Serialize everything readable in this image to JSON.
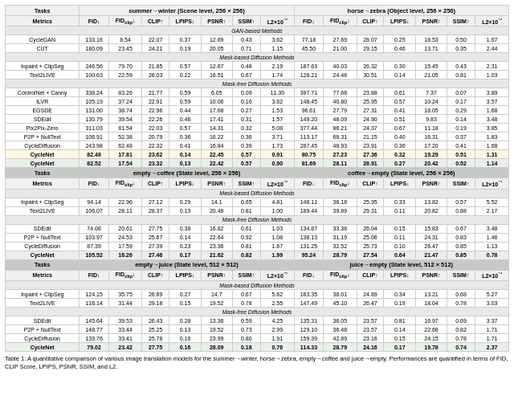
{
  "caption": "Table 1: A quantitative comparison of various image translation models for the summer→winter, horse→zebra, empty→coffee and juice→empty. Performances are quantified in terms of FID, CLIP Score, LPIPS, PSNR, SSIM, and L2.",
  "sections": [
    {
      "tasks_label": "Tasks",
      "task1": "summer→winter (Scene level, 256 × 256)",
      "task2": "horse→zebra (Object level, 256 × 256)",
      "metrics_label": "Metrics",
      "cols": [
        "FID↓",
        "FID_clip↓",
        "CLIP↑",
        "LPIPS↓",
        "PSNR↑",
        "SSIM↑",
        "L2×10⁻¹",
        "FID↓",
        "FID_clip↓",
        "CLIP↑",
        "LPIPS↓",
        "PSNR↑",
        "SSIM↑",
        "L2×10⁻¹"
      ],
      "gan_methods_label": "GAN-based Methods",
      "gan_rows": [
        {
          "name": "CycleGAN",
          "vals": [
            "133.16",
            "8.54",
            "22.07",
            "0.37",
            "12.69",
            "0.43",
            "3.62",
            "77.18",
            "27.69",
            "28.07",
            "0.25",
            "18.53",
            "0.50",
            "1.67"
          ]
        },
        {
          "name": "CUT",
          "vals": [
            "180.09",
            "23.45",
            "24.21",
            "0.19",
            "20.05",
            "0.71",
            "1.15",
            "45.50",
            "21.00",
            "29.15",
            "0.46",
            "13.71",
            "0.35",
            "2.44"
          ]
        }
      ],
      "mask_methods_label": "Mask-based Diffusion Methods",
      "mask_rows": [
        {
          "name": "Inpaint + ClipSeg",
          "vals": [
            "246.56",
            "79.70",
            "21.85",
            "0.57",
            "12.67",
            "0.48",
            "2.19",
            "187.63",
            "40.03",
            "26.32",
            "0.30",
            "15.45",
            "0.43",
            "2.31"
          ]
        },
        {
          "name": "Text2LIVE",
          "vals": [
            "100.63",
            "22.59",
            "26.03",
            "0.22",
            "16.51",
            "0.67",
            "1.74",
            "128.21",
            "24.46",
            "30.51",
            "0.14",
            "21.05",
            "0.81",
            "1.03"
          ]
        }
      ],
      "free_methods_label": "Mask-free Diffusion Methods",
      "free_rows": [
        {
          "name": "ControlNet + Canny",
          "vals": [
            "338.24",
            "83.26",
            "21.77",
            "0.59",
            "6.05",
            "0.09",
            "11.30",
            "397.71",
            "77.68",
            "23.88",
            "0.61",
            "7.37",
            "0.07",
            "3.89"
          ]
        },
        {
          "name": "ILVR",
          "vals": [
            "105.19",
            "37.24",
            "22.91",
            "0.59",
            "10.06",
            "0.16",
            "3.62",
            "148.45",
            "40.80",
            "25.95",
            "0.57",
            "10.24",
            "0.17",
            "3.57"
          ]
        },
        {
          "name": "EGSDE",
          "vals": [
            "131.00",
            "38.74",
            "22.96",
            "0.44",
            "17.68",
            "0.27",
            "1.53",
            "96.61",
            "27.79",
            "27.31",
            "0.41",
            "18.05",
            "0.29",
            "1.68"
          ]
        },
        {
          "name": "SDEdit",
          "vals": [
            "130.79",
            "39.54",
            "22.26",
            "0.46",
            "17.41",
            "0.31",
            "1.57",
            "149.20",
            "48.09",
            "24.90",
            "0.51",
            "9.83",
            "0.14",
            "3.48"
          ]
        },
        {
          "name": "Pix2Pix-Zero",
          "vals": [
            "311.03",
            "81.54",
            "22.03",
            "0.57",
            "14.31",
            "0.32",
            "5.08",
            "377.44",
            "86.21",
            "24.37",
            "0.67",
            "11.18",
            "0.19",
            "3.85"
          ]
        },
        {
          "name": "P2P + NullText",
          "vals": [
            "106.91",
            "52.38",
            "20.79",
            "0.36",
            "16.22",
            "0.36",
            "3.71",
            "113.17",
            "68.31",
            "21.15",
            "0.40",
            "16.31",
            "0.37",
            "1.83"
          ]
        },
        {
          "name": "CycleDiffusion",
          "vals": [
            "243.98",
            "62.48",
            "22.32",
            "0.41",
            "16.84",
            "0.39",
            "1.73",
            "287.45",
            "48.93",
            "23.91",
            "0.36",
            "17.20",
            "0.41",
            "1.68"
          ]
        },
        {
          "name": "CycleNet",
          "vals": [
            "82.48",
            "17.81",
            "23.62",
            "0.14",
            "22.45",
            "0.57",
            "0.91",
            "80.75",
            "27.23",
            "27.36",
            "0.32",
            "19.29",
            "0.51",
            "1.31"
          ],
          "bold": true
        },
        {
          "name": "CycleNet",
          "vals": [
            "82.52",
            "17.54",
            "23.32",
            "0.13",
            "22.42",
            "0.57",
            "0.90",
            "81.69",
            "28.11",
            "28.91",
            "0.27",
            "20.42",
            "0.52",
            "1.14"
          ],
          "bold": true
        }
      ]
    },
    {
      "tasks_label": "Tasks",
      "task1": "empty→coffee (State level, 256 × 256)",
      "task2": "coffee→empty (State level, 256 × 256)",
      "cols": [
        "FID↓",
        "FID_clip↓",
        "CLIP↑",
        "LPIPS↓",
        "PSNR↑",
        "SSIM↑",
        "L2×10⁻¹",
        "FID↓",
        "FID_clip↓",
        "CLIP↑",
        "LPIPS↓",
        "PSNR↑",
        "SSIM↑",
        "L2×10⁻¹"
      ],
      "mask_rows": [
        {
          "name": "Inpaint + ClipSeg",
          "vals": [
            "94.14",
            "22.96",
            "27.12",
            "0.29",
            "14.1",
            "0.65",
            "4.81",
            "148.11",
            "36.18",
            "25.95",
            "0.33",
            "13.82",
            "0.57",
            "5.52"
          ]
        },
        {
          "name": "Text2LIVE",
          "vals": [
            "106.07",
            "28.11",
            "28.37",
            "0.13",
            "20.48",
            "0.81",
            "1.00",
            "189.44",
            "39.89",
            "29.31",
            "0.11",
            "20.82",
            "0.88",
            "2.17"
          ]
        }
      ],
      "free_rows": [
        {
          "name": "SDEdit",
          "vals": [
            "74.08",
            "20.61",
            "27.75",
            "0.38",
            "16.82",
            "0.61",
            "1.03",
            "134.87",
            "33.38",
            "26.04",
            "0.15",
            "15.83",
            "0.67",
            "3.48"
          ]
        },
        {
          "name": "P2P + NullText",
          "vals": [
            "103.97",
            "24.53",
            "25.67",
            "0.14",
            "22.64",
            "0.92",
            "1.08",
            "138.13",
            "31.19",
            "25.06",
            "0.11",
            "24.31",
            "0.83",
            "1.46"
          ]
        },
        {
          "name": "CycleDiffusion",
          "vals": [
            "87.39",
            "17.59",
            "27.39",
            "0.23",
            "23.36",
            "0.81",
            "1.67",
            "131.25",
            "32.52",
            "25.73",
            "0.10",
            "26.47",
            "0.85",
            "1.13"
          ]
        },
        {
          "name": "CycleNet",
          "vals": [
            "105.52",
            "16.26",
            "27.46",
            "0.17",
            "21.62",
            "0.82",
            "1.99",
            "95.24",
            "28.79",
            "27.54",
            "0.64",
            "21.47",
            "0.85",
            "0.78"
          ],
          "bold": true
        }
      ]
    },
    {
      "tasks_label": "Tasks",
      "task1": "empty→juice (State level, 512 × 512)",
      "task2": "juice→empty (State level, 512 × 512)",
      "cols": [
        "FID↓",
        "FID_clip↓",
        "CLIP↑",
        "LPIPS↓",
        "PSNR↑",
        "SSIM↑",
        "L2×10⁻¹",
        "FID↓",
        "FID_clip↓",
        "CLIP↑",
        "LPIPS↓",
        "PSNR↑",
        "SSIM↑",
        "L2×10⁻¹"
      ],
      "mask_rows": [
        {
          "name": "Inpaint + ClipSeg",
          "vals": [
            "124.15",
            "35.75",
            "26.69",
            "0.27",
            "14.7",
            "0.67",
            "5.62",
            "163.35",
            "38.01",
            "24.89",
            "0.34",
            "13.21",
            "0.68",
            "5.27"
          ]
        },
        {
          "name": "Text2LIVE",
          "vals": [
            "116.14",
            "31.44",
            "29.18",
            "0.15",
            "19.52",
            "0.78",
            "2.55",
            "147.49",
            "45.10",
            "26.47",
            "0.19",
            "18.04",
            "0.78",
            "3.03"
          ]
        }
      ],
      "free_rows": [
        {
          "name": "SDEdit",
          "vals": [
            "145.64",
            "39.53",
            "26.43",
            "0.28",
            "13.36",
            "0.59",
            "4.25",
            "135.31",
            "36.05",
            "23.57",
            "0.81",
            "16.97",
            "0.69",
            "3.37"
          ]
        },
        {
          "name": "P2P + NullText",
          "vals": [
            "148.77",
            "33.44",
            "25.25",
            "0.13",
            "19.52",
            "0.73",
            "2.99",
            "129.10",
            "36.48",
            "23.57",
            "0.14",
            "22.68",
            "0.82",
            "1.71"
          ]
        },
        {
          "name": "CycleDiffusion",
          "vals": [
            "139.76",
            "33.41",
            "25.78",
            "0.16",
            "23.99",
            "0.80",
            "1.91",
            "159.39",
            "42.89",
            "23.16",
            "0.15",
            "24.15",
            "0.78",
            "1.71"
          ]
        },
        {
          "name": "CycleNet",
          "vals": [
            "79.02",
            "23.42",
            "27.75",
            "0.16",
            "28.09",
            "0.18",
            "0.76",
            "114.33",
            "28.79",
            "24.16",
            "0.17",
            "19.78",
            "0.74",
            "2.37"
          ],
          "bold": true
        }
      ]
    }
  ]
}
